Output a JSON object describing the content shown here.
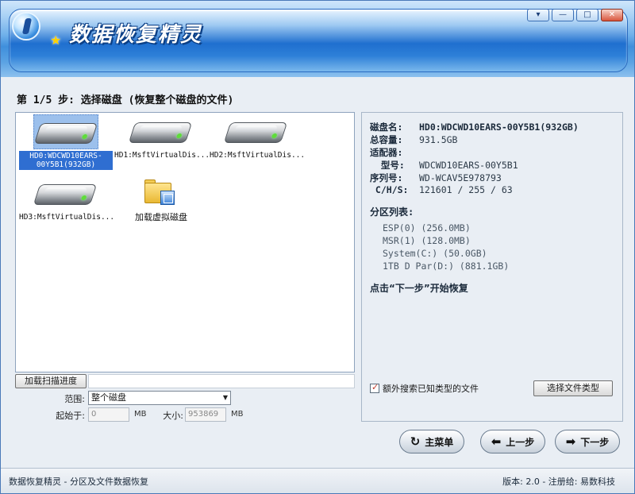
{
  "window": {
    "app_title": "数据恢复精灵",
    "controls": {
      "menu": "▾",
      "minimize": "—",
      "maximize": "□",
      "close": "✕"
    }
  },
  "step_title": "第 1/5 步: 选择磁盘 (恢复整个磁盘的文件)",
  "disks": [
    {
      "label": "HD0:WDCWD10EARS-00Y5B1(932GB)",
      "selected": true,
      "icon": "hard-disk-icon"
    },
    {
      "label": "HD1:MsftVirtualDis...",
      "selected": false,
      "icon": "hard-disk-icon"
    },
    {
      "label": "HD2:MsftVirtualDis...",
      "selected": false,
      "icon": "hard-disk-icon"
    },
    {
      "label": "HD3:MsftVirtualDis...",
      "selected": false,
      "icon": "hard-disk-icon"
    },
    {
      "label": "加载虚拟磁盘",
      "selected": false,
      "icon": "folder-icon"
    }
  ],
  "scan": {
    "load_progress_label": "加载扫描进度",
    "scope_label": "范围:",
    "scope_value": "整个磁盘",
    "start_label": "起始于:",
    "start_value": "0",
    "start_unit": "MB",
    "size_label": "大小:",
    "size_value": "953869",
    "size_unit": "MB"
  },
  "info": {
    "rows": [
      {
        "key": "磁盘名:",
        "value": "HD0:WDCWD10EARS-00Y5B1(932GB)"
      },
      {
        "key": "总容量:",
        "value": "931.5GB"
      },
      {
        "key": "适配器:",
        "value": ""
      },
      {
        "key": "  型号:",
        "value": "WDCWD10EARS-00Y5B1"
      },
      {
        "key": "序列号:",
        "value": "WD-WCAV5E978793"
      },
      {
        "key": " C/H/S:",
        "value": "121601 / 255 / 63"
      }
    ],
    "partition_heading": "分区列表:",
    "partitions": [
      "ESP(0) (256.0MB)",
      "MSR(1) (128.0MB)",
      "System(C:) (50.0GB)",
      "1TB D Par(D:) (881.1GB)"
    ],
    "hint": "点击“下一步”开始恢复",
    "extra_search_label": "额外搜索已知类型的文件",
    "extra_search_checked": true,
    "select_types_label": "选择文件类型"
  },
  "nav": {
    "main_menu": "主菜单",
    "prev": "上一步",
    "next": "下一步"
  },
  "status": {
    "left": "数据恢复精灵 - 分区及文件数据恢复",
    "right": "版本: 2.0 - 注册给: 易数科技"
  }
}
